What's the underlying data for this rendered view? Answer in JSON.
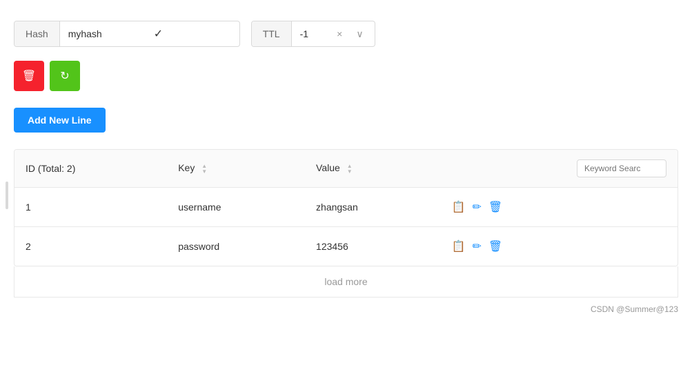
{
  "header": {
    "hash_label": "Hash",
    "hash_value": "myhash",
    "ttl_label": "TTL",
    "ttl_value": "-1"
  },
  "buttons": {
    "delete_label": "🗑",
    "refresh_label": "↻",
    "add_new_label": "Add New Line"
  },
  "table": {
    "col_id": "ID (Total: 2)",
    "col_key": "Key",
    "col_value": "Value",
    "keyword_placeholder": "Keyword Searc",
    "rows": [
      {
        "id": "1",
        "key": "username",
        "value": "zhangsan"
      },
      {
        "id": "2",
        "key": "password",
        "value": "123456"
      }
    ]
  },
  "load_more": "load more",
  "footer": "CSDN @Summer@123",
  "icons": {
    "check": "✓",
    "close": "×",
    "chevron_down": "∨",
    "sort_up": "▲",
    "sort_down": "▼",
    "copy": "📋",
    "edit": "✏",
    "delete": "🗑"
  }
}
